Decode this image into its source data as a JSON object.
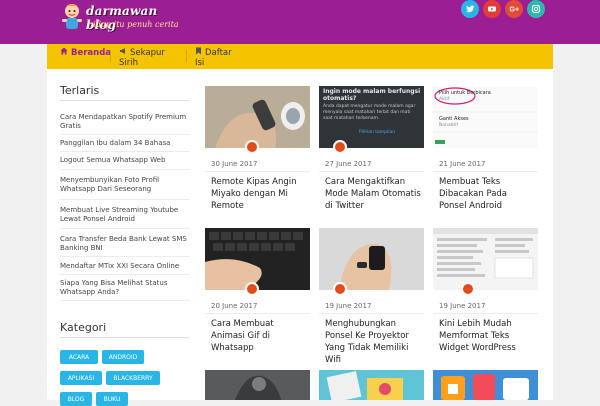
{
  "site": {
    "title": "darmawan blog",
    "tagline": "hidup itu penuh cerita"
  },
  "social": [
    {
      "icon": "twitter-icon",
      "color": "#29b6e6"
    },
    {
      "icon": "youtube-icon",
      "color": "#e23b3b"
    },
    {
      "icon": "google-plus-icon",
      "color": "#e24b3a"
    },
    {
      "icon": "instagram-icon",
      "color": "#2fb7b0"
    }
  ],
  "nav": {
    "items": [
      {
        "label": "Beranda",
        "icon": "home-icon",
        "active": true
      },
      {
        "label": "Sekapur Sirih",
        "icon": "megaphone-icon",
        "active": false
      },
      {
        "label": "Daftar Isi",
        "icon": "bookmark-icon",
        "active": false
      }
    ]
  },
  "sidebar": {
    "terlaris_title": "Terlaris",
    "terlaris": [
      "Cara Mendapatkan Spotify Premium Gratis",
      "Panggilan Ibu dalam 34 Bahasa",
      "Logout Semua Whatsapp Web",
      "Menyembunyikan Foto Profil Whatsapp Dari Seseorang",
      "Membuat Live Streaming Youtube Lewat Ponsel Android",
      "Cara Transfer Beda Bank Lewat SMS Banking BNI",
      "Mendaftar MTix XXI Secara Online",
      "Siapa Yang Bisa Melihat Status Whatsapp Anda?"
    ],
    "kategori_title": "Kategori",
    "kategori": [
      "ACARA",
      "ANDROID",
      "APLIKASI",
      "BLACKBERRY",
      "BLOG",
      "BUKU"
    ]
  },
  "posts": [
    {
      "date": "30 June 2017",
      "title": "Remote Kipas Angin Miyako dengan Mi Remote"
    },
    {
      "date": "27 June 2017",
      "title": "Cara Mengaktifkan Mode Malam Otomatis di Twitter",
      "thumb_text": "Ingin mode malam berfungsi otomatis?",
      "thumb_body": "Anda dapat mengatur mode malam agar menyala saat matahari terbit dan mati saat matahari terbenam.",
      "thumb_link": "Pilihan tampilan"
    },
    {
      "date": "21 June 2017",
      "title": "Membuat Teks Dibacakan Pada Ponsel Android",
      "thumb_text": "Pilih untuk Berbicara",
      "thumb_sub": "Aktif",
      "thumb_item": "Ganti Akses",
      "thumb_item_sub": "Nonaktif"
    },
    {
      "date": "20 June 2017",
      "title": "Cara Membuat Animasi Gif di Whatsapp"
    },
    {
      "date": "19 June 2017",
      "title": "Menghubungkan Ponsel Ke Proyektor Yang Tidak Memiliki Wifi"
    },
    {
      "date": "19 June 2017",
      "title": "Kini Lebih Mudah Memformat Teks Widget WordPress"
    }
  ],
  "colors": {
    "header_bg": "#9c1e93",
    "nav_bg": "#f5c400",
    "accent_dot": "#e24b1e",
    "tag_bg": "#29b6e6"
  }
}
